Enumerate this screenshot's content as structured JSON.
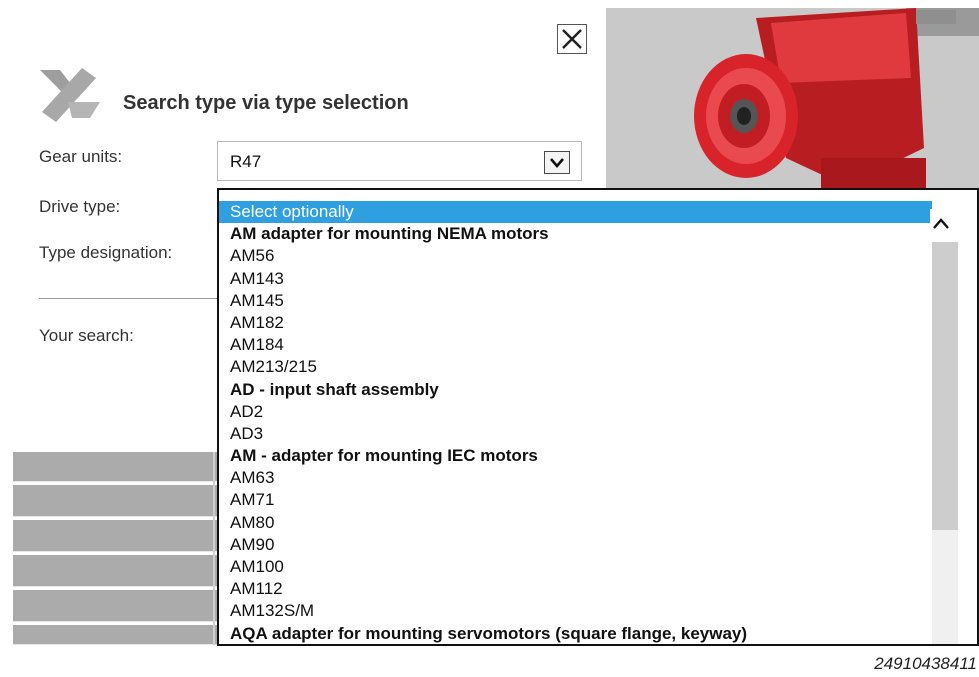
{
  "dialog": {
    "title": "Search type via type selection",
    "close_icon": "close-icon",
    "logo_icon": "gear-search-logo-icon"
  },
  "form": {
    "gear_units_label": "Gear units:",
    "gear_units_value": "R47",
    "drive_type_label": "Drive type:",
    "type_designation_label": "Type designation:",
    "your_search_label": "Your search:"
  },
  "dropdown": {
    "options": [
      {
        "label": "Select optionally",
        "selected": true,
        "group": false
      },
      {
        "label": "AM adapter for mounting NEMA motors",
        "selected": false,
        "group": true
      },
      {
        "label": "AM56",
        "selected": false,
        "group": false
      },
      {
        "label": "AM143",
        "selected": false,
        "group": false
      },
      {
        "label": "AM145",
        "selected": false,
        "group": false
      },
      {
        "label": "AM182",
        "selected": false,
        "group": false
      },
      {
        "label": "AM184",
        "selected": false,
        "group": false
      },
      {
        "label": "AM213/215",
        "selected": false,
        "group": false
      },
      {
        "label": "AD - input shaft assembly",
        "selected": false,
        "group": true
      },
      {
        "label": "AD2",
        "selected": false,
        "group": false
      },
      {
        "label": "AD3",
        "selected": false,
        "group": false
      },
      {
        "label": "AM - adapter for mounting IEC motors",
        "selected": false,
        "group": true
      },
      {
        "label": "AM63",
        "selected": false,
        "group": false
      },
      {
        "label": "AM71",
        "selected": false,
        "group": false
      },
      {
        "label": "AM80",
        "selected": false,
        "group": false
      },
      {
        "label": "AM90",
        "selected": false,
        "group": false
      },
      {
        "label": "AM100",
        "selected": false,
        "group": false
      },
      {
        "label": "AM112",
        "selected": false,
        "group": false
      },
      {
        "label": "AM132S/M",
        "selected": false,
        "group": false
      },
      {
        "label": "AQA adapter for mounting servomotors (square flange, keyway)",
        "selected": false,
        "group": true
      }
    ]
  },
  "figure_reference": "24910438411",
  "colors": {
    "selection": "#2f9fe0",
    "product_red": "#d8232a",
    "photo_background": "#c9c9c9",
    "table_gray": "#ababab"
  }
}
